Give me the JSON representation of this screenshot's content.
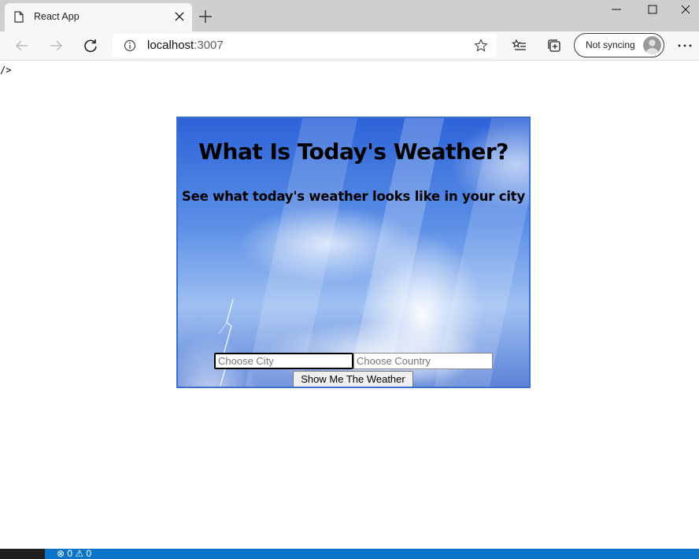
{
  "browser": {
    "tab_title": "React App",
    "url_host": "localhost",
    "url_port": ":3007",
    "sync_label": "Not syncing"
  },
  "page": {
    "stray_text": "/>",
    "title": "What Is Today's Weather?",
    "subtitle": "See what today's weather looks like in your city",
    "city_placeholder": "Choose City",
    "city_value": "",
    "country_placeholder": "Choose Country",
    "country_value": "",
    "submit_label": "Show Me The Weather"
  },
  "statusbar": {
    "errors": "0",
    "warnings": "0"
  },
  "colors": {
    "card_border": "#3a6fd0",
    "status_bar": "#0a74c9"
  }
}
